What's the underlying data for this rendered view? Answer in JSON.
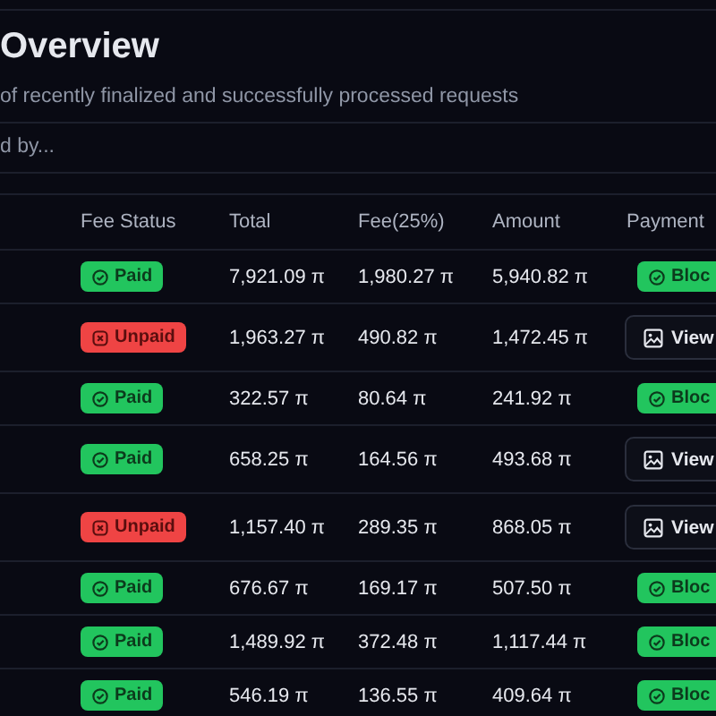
{
  "title": "Overview",
  "subtitle": "of recently finalized and successfully processed requests",
  "filter": "d by...",
  "table": {
    "columns": [
      "Fee Status",
      "Total",
      "Fee(25%)",
      "Amount",
      "Payment"
    ],
    "rows": [
      {
        "fee_status": {
          "kind": "paid",
          "label": "Paid"
        },
        "total": "7,921.09 π",
        "fee": "1,980.27 π",
        "amount": "5,940.82 π",
        "payment": {
          "kind": "block",
          "label": "Bloc"
        }
      },
      {
        "fee_status": {
          "kind": "unpaid",
          "label": "Unpaid"
        },
        "total": "1,963.27 π",
        "fee": "490.82 π",
        "amount": "1,472.45 π",
        "payment": {
          "kind": "view",
          "label": "View"
        }
      },
      {
        "fee_status": {
          "kind": "paid",
          "label": "Paid"
        },
        "total": "322.57 π",
        "fee": "80.64 π",
        "amount": "241.92 π",
        "payment": {
          "kind": "block",
          "label": "Bloc"
        }
      },
      {
        "fee_status": {
          "kind": "paid",
          "label": "Paid"
        },
        "total": "658.25 π",
        "fee": "164.56 π",
        "amount": "493.68 π",
        "payment": {
          "kind": "view",
          "label": "View"
        }
      },
      {
        "fee_status": {
          "kind": "unpaid",
          "label": "Unpaid"
        },
        "total": "1,157.40 π",
        "fee": "289.35 π",
        "amount": "868.05 π",
        "payment": {
          "kind": "view",
          "label": "View"
        }
      },
      {
        "fee_status": {
          "kind": "paid",
          "label": "Paid"
        },
        "total": "676.67 π",
        "fee": "169.17 π",
        "amount": "507.50 π",
        "payment": {
          "kind": "block",
          "label": "Bloc"
        }
      },
      {
        "fee_status": {
          "kind": "paid",
          "label": "Paid"
        },
        "total": "1,489.92 π",
        "fee": "372.48 π",
        "amount": "1,117.44 π",
        "payment": {
          "kind": "block",
          "label": "Bloc"
        }
      },
      {
        "fee_status": {
          "kind": "paid",
          "label": "Paid"
        },
        "total": "546.19 π",
        "fee": "136.55 π",
        "amount": "409.64 π",
        "payment": {
          "kind": "block",
          "label": "Bloc"
        }
      }
    ]
  }
}
